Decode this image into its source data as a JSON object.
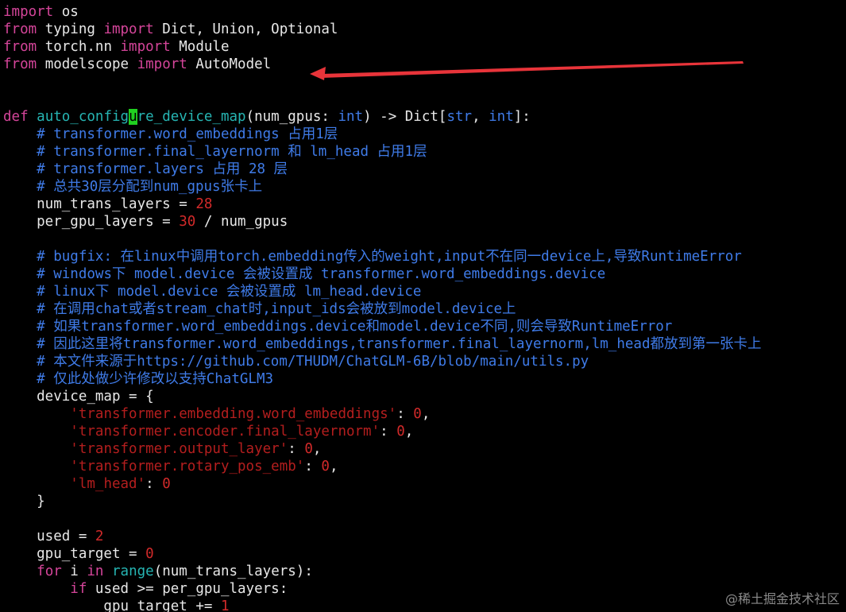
{
  "editor": {
    "lines": [
      {
        "segments": [
          {
            "t": "import",
            "c": "kw"
          },
          {
            "t": " os",
            "c": ""
          }
        ]
      },
      {
        "segments": [
          {
            "t": "from",
            "c": "kw"
          },
          {
            "t": " typing ",
            "c": ""
          },
          {
            "t": "import",
            "c": "kw"
          },
          {
            "t": " Dict, Union, Optional",
            "c": ""
          }
        ]
      },
      {
        "segments": [
          {
            "t": "from",
            "c": "kw"
          },
          {
            "t": " torch.nn ",
            "c": ""
          },
          {
            "t": "import",
            "c": "kw"
          },
          {
            "t": " Module",
            "c": ""
          }
        ]
      },
      {
        "segments": [
          {
            "t": "from",
            "c": "kw"
          },
          {
            "t": " modelscope ",
            "c": ""
          },
          {
            "t": "import",
            "c": "kw"
          },
          {
            "t": " AutoModel",
            "c": ""
          }
        ]
      },
      {
        "segments": []
      },
      {
        "segments": []
      },
      {
        "segments": [
          {
            "t": "def",
            "c": "kw"
          },
          {
            "t": " ",
            "c": ""
          },
          {
            "t": "auto_config",
            "c": "fn"
          },
          {
            "t": "u",
            "c": "cursor"
          },
          {
            "t": "re_device_map",
            "c": "fn"
          },
          {
            "t": "(num_gpus: ",
            "c": ""
          },
          {
            "t": "int",
            "c": "ty"
          },
          {
            "t": ") -> Dict[",
            "c": ""
          },
          {
            "t": "str",
            "c": "ty"
          },
          {
            "t": ", ",
            "c": ""
          },
          {
            "t": "int",
            "c": "ty"
          },
          {
            "t": "]:",
            "c": ""
          }
        ]
      },
      {
        "segments": [
          {
            "t": "    ",
            "c": ""
          },
          {
            "t": "# transformer.word_embeddings 占用1层",
            "c": "cm"
          }
        ]
      },
      {
        "segments": [
          {
            "t": "    ",
            "c": ""
          },
          {
            "t": "# transformer.final_layernorm 和 lm_head 占用1层",
            "c": "cm"
          }
        ]
      },
      {
        "segments": [
          {
            "t": "    ",
            "c": ""
          },
          {
            "t": "# transformer.layers 占用 28 层",
            "c": "cm"
          }
        ]
      },
      {
        "segments": [
          {
            "t": "    ",
            "c": ""
          },
          {
            "t": "# 总共30层分配到num_gpus张卡上",
            "c": "cm"
          }
        ]
      },
      {
        "segments": [
          {
            "t": "    num_trans_layers = ",
            "c": ""
          },
          {
            "t": "28",
            "c": "num"
          }
        ]
      },
      {
        "segments": [
          {
            "t": "    per_gpu_layers = ",
            "c": ""
          },
          {
            "t": "30",
            "c": "num"
          },
          {
            "t": " / num_gpus",
            "c": ""
          }
        ]
      },
      {
        "segments": []
      },
      {
        "segments": [
          {
            "t": "    ",
            "c": ""
          },
          {
            "t": "# bugfix: 在linux中调用torch.embedding传入的weight,input不在同一device上,导致RuntimeError",
            "c": "cm"
          }
        ]
      },
      {
        "segments": [
          {
            "t": "    ",
            "c": ""
          },
          {
            "t": "# windows下 model.device 会被设置成 transformer.word_embeddings.device",
            "c": "cm"
          }
        ]
      },
      {
        "segments": [
          {
            "t": "    ",
            "c": ""
          },
          {
            "t": "# linux下 model.device 会被设置成 lm_head.device",
            "c": "cm"
          }
        ]
      },
      {
        "segments": [
          {
            "t": "    ",
            "c": ""
          },
          {
            "t": "# 在调用chat或者stream_chat时,input_ids会被放到model.device上",
            "c": "cm"
          }
        ]
      },
      {
        "segments": [
          {
            "t": "    ",
            "c": ""
          },
          {
            "t": "# 如果transformer.word_embeddings.device和model.device不同,则会导致RuntimeError",
            "c": "cm"
          }
        ]
      },
      {
        "segments": [
          {
            "t": "    ",
            "c": ""
          },
          {
            "t": "# 因此这里将transformer.word_embeddings,transformer.final_layernorm,lm_head都放到第一张卡上",
            "c": "cm"
          }
        ]
      },
      {
        "segments": [
          {
            "t": "    ",
            "c": ""
          },
          {
            "t": "# 本文件来源于https://github.com/THUDM/ChatGLM-6B/blob/main/utils.py",
            "c": "cm"
          }
        ]
      },
      {
        "segments": [
          {
            "t": "    ",
            "c": ""
          },
          {
            "t": "# 仅此处做少许修改以支持ChatGLM3",
            "c": "cm"
          }
        ]
      },
      {
        "segments": [
          {
            "t": "    device_map = {",
            "c": ""
          }
        ]
      },
      {
        "segments": [
          {
            "t": "        ",
            "c": ""
          },
          {
            "t": "'transformer.embedding.word_embeddings'",
            "c": "st"
          },
          {
            "t": ": ",
            "c": ""
          },
          {
            "t": "0",
            "c": "num"
          },
          {
            "t": ",",
            "c": ""
          }
        ]
      },
      {
        "segments": [
          {
            "t": "        ",
            "c": ""
          },
          {
            "t": "'transformer.encoder.final_layernorm'",
            "c": "st"
          },
          {
            "t": ": ",
            "c": ""
          },
          {
            "t": "0",
            "c": "num"
          },
          {
            "t": ",",
            "c": ""
          }
        ]
      },
      {
        "segments": [
          {
            "t": "        ",
            "c": ""
          },
          {
            "t": "'transformer.output_layer'",
            "c": "st"
          },
          {
            "t": ": ",
            "c": ""
          },
          {
            "t": "0",
            "c": "num"
          },
          {
            "t": ",",
            "c": ""
          }
        ]
      },
      {
        "segments": [
          {
            "t": "        ",
            "c": ""
          },
          {
            "t": "'transformer.rotary_pos_emb'",
            "c": "st"
          },
          {
            "t": ": ",
            "c": ""
          },
          {
            "t": "0",
            "c": "num"
          },
          {
            "t": ",",
            "c": ""
          }
        ]
      },
      {
        "segments": [
          {
            "t": "        ",
            "c": ""
          },
          {
            "t": "'lm_head'",
            "c": "st"
          },
          {
            "t": ": ",
            "c": ""
          },
          {
            "t": "0",
            "c": "num"
          }
        ]
      },
      {
        "segments": [
          {
            "t": "    }",
            "c": ""
          }
        ]
      },
      {
        "segments": []
      },
      {
        "segments": [
          {
            "t": "    used = ",
            "c": ""
          },
          {
            "t": "2",
            "c": "num"
          }
        ]
      },
      {
        "segments": [
          {
            "t": "    gpu_target = ",
            "c": ""
          },
          {
            "t": "0",
            "c": "num"
          }
        ]
      },
      {
        "segments": [
          {
            "t": "    ",
            "c": ""
          },
          {
            "t": "for",
            "c": "kw"
          },
          {
            "t": " i ",
            "c": ""
          },
          {
            "t": "in",
            "c": "kw"
          },
          {
            "t": " ",
            "c": ""
          },
          {
            "t": "range",
            "c": "fn"
          },
          {
            "t": "(num_trans_layers):",
            "c": ""
          }
        ]
      },
      {
        "segments": [
          {
            "t": "        ",
            "c": ""
          },
          {
            "t": "if",
            "c": "kw"
          },
          {
            "t": " used >= per_gpu_layers:",
            "c": ""
          }
        ]
      },
      {
        "segments": [
          {
            "t": "            gpu_target += ",
            "c": ""
          },
          {
            "t": "1",
            "c": "num"
          }
        ]
      }
    ]
  },
  "colors": {
    "keyword": "#d5459a",
    "function": "#26b5b3",
    "comment": "#3f7be8",
    "number": "#d22a2a",
    "string": "#b41e1e",
    "cursor": "#20d020",
    "annotation_arrow": "#e8343a"
  },
  "watermark": "@稀土掘金技术社区"
}
